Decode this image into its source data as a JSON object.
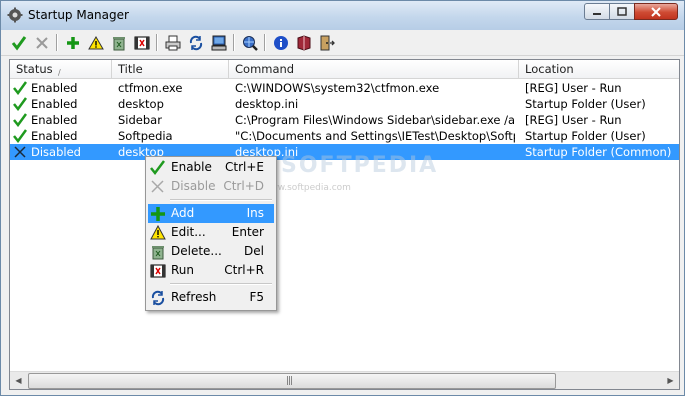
{
  "window": {
    "title": "Startup Manager"
  },
  "toolbar": {
    "buttons": [
      {
        "name": "enable-check-icon"
      },
      {
        "name": "disable-x-icon"
      },
      {
        "name": "add-plus-icon"
      },
      {
        "name": "edit-warning-icon"
      },
      {
        "name": "delete-recycle-icon"
      },
      {
        "name": "run-film-icon"
      },
      {
        "name": "print-icon"
      },
      {
        "name": "refresh-icon"
      },
      {
        "name": "computer-icon"
      },
      {
        "name": "search-globe-icon"
      },
      {
        "name": "info-icon"
      },
      {
        "name": "help-book-icon"
      },
      {
        "name": "exit-door-icon"
      }
    ]
  },
  "list": {
    "columns": [
      "Status",
      "Title",
      "Command",
      "Location"
    ],
    "rows": [
      {
        "status": "Enabled",
        "title": "ctfmon.exe",
        "command": "C:\\WINDOWS\\system32\\ctfmon.exe",
        "location": "[REG] User - Run",
        "state": "enabled"
      },
      {
        "status": "Enabled",
        "title": "desktop",
        "command": "desktop.ini",
        "location": "Startup Folder (User)",
        "state": "enabled"
      },
      {
        "status": "Enabled",
        "title": "Sidebar",
        "command": "C:\\Program Files\\Windows Sidebar\\sidebar.exe /autoRun",
        "location": "[REG] User - Run",
        "state": "enabled"
      },
      {
        "status": "Enabled",
        "title": "Softpedia",
        "command": "\"C:\\Documents and Settings\\IETest\\Desktop\\Softpedia....",
        "location": "Startup Folder (User)",
        "state": "enabled"
      },
      {
        "status": "Disabled",
        "title": "desktop",
        "command": "desktop.ini",
        "location": "Startup Folder (Common)",
        "state": "disabled"
      }
    ]
  },
  "context_menu": {
    "items": [
      {
        "label": "Enable",
        "shortcut": "Ctrl+E"
      },
      {
        "label": "Disable",
        "shortcut": "Ctrl+D"
      },
      {
        "label": "Add",
        "shortcut": "Ins"
      },
      {
        "label": "Edit...",
        "shortcut": "Enter"
      },
      {
        "label": "Delete...",
        "shortcut": "Del"
      },
      {
        "label": "Run",
        "shortcut": "Ctrl+R"
      },
      {
        "label": "Refresh",
        "shortcut": "F5"
      }
    ]
  },
  "watermark": {
    "text": "SOFTPEDIA",
    "url": "www.softpedia.com"
  },
  "colors": {
    "selection": "#3399ff",
    "check_green": "#1f9a1f"
  }
}
